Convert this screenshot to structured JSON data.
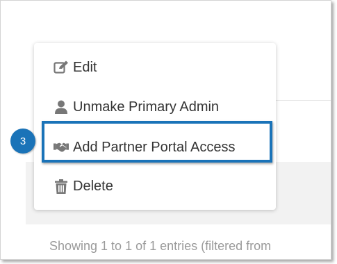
{
  "menu": {
    "edit": {
      "label": "Edit",
      "icon": "edit-icon"
    },
    "unmake_primary_admin": {
      "label": "Unmake Primary Admin",
      "icon": "user-icon"
    },
    "add_partner_portal_access": {
      "label": "Add Partner Portal Access",
      "icon": "handshake-icon"
    },
    "delete": {
      "label": "Delete",
      "icon": "trash-icon"
    }
  },
  "callout": {
    "step_number": "3",
    "color": "#1a73b8"
  },
  "table_info": {
    "text": "Showing 1 to 1 of 1 entries (filtered from"
  },
  "colors": {
    "menu_text": "#333333",
    "icon": "#777777",
    "footer_text": "#9a9a9a"
  }
}
